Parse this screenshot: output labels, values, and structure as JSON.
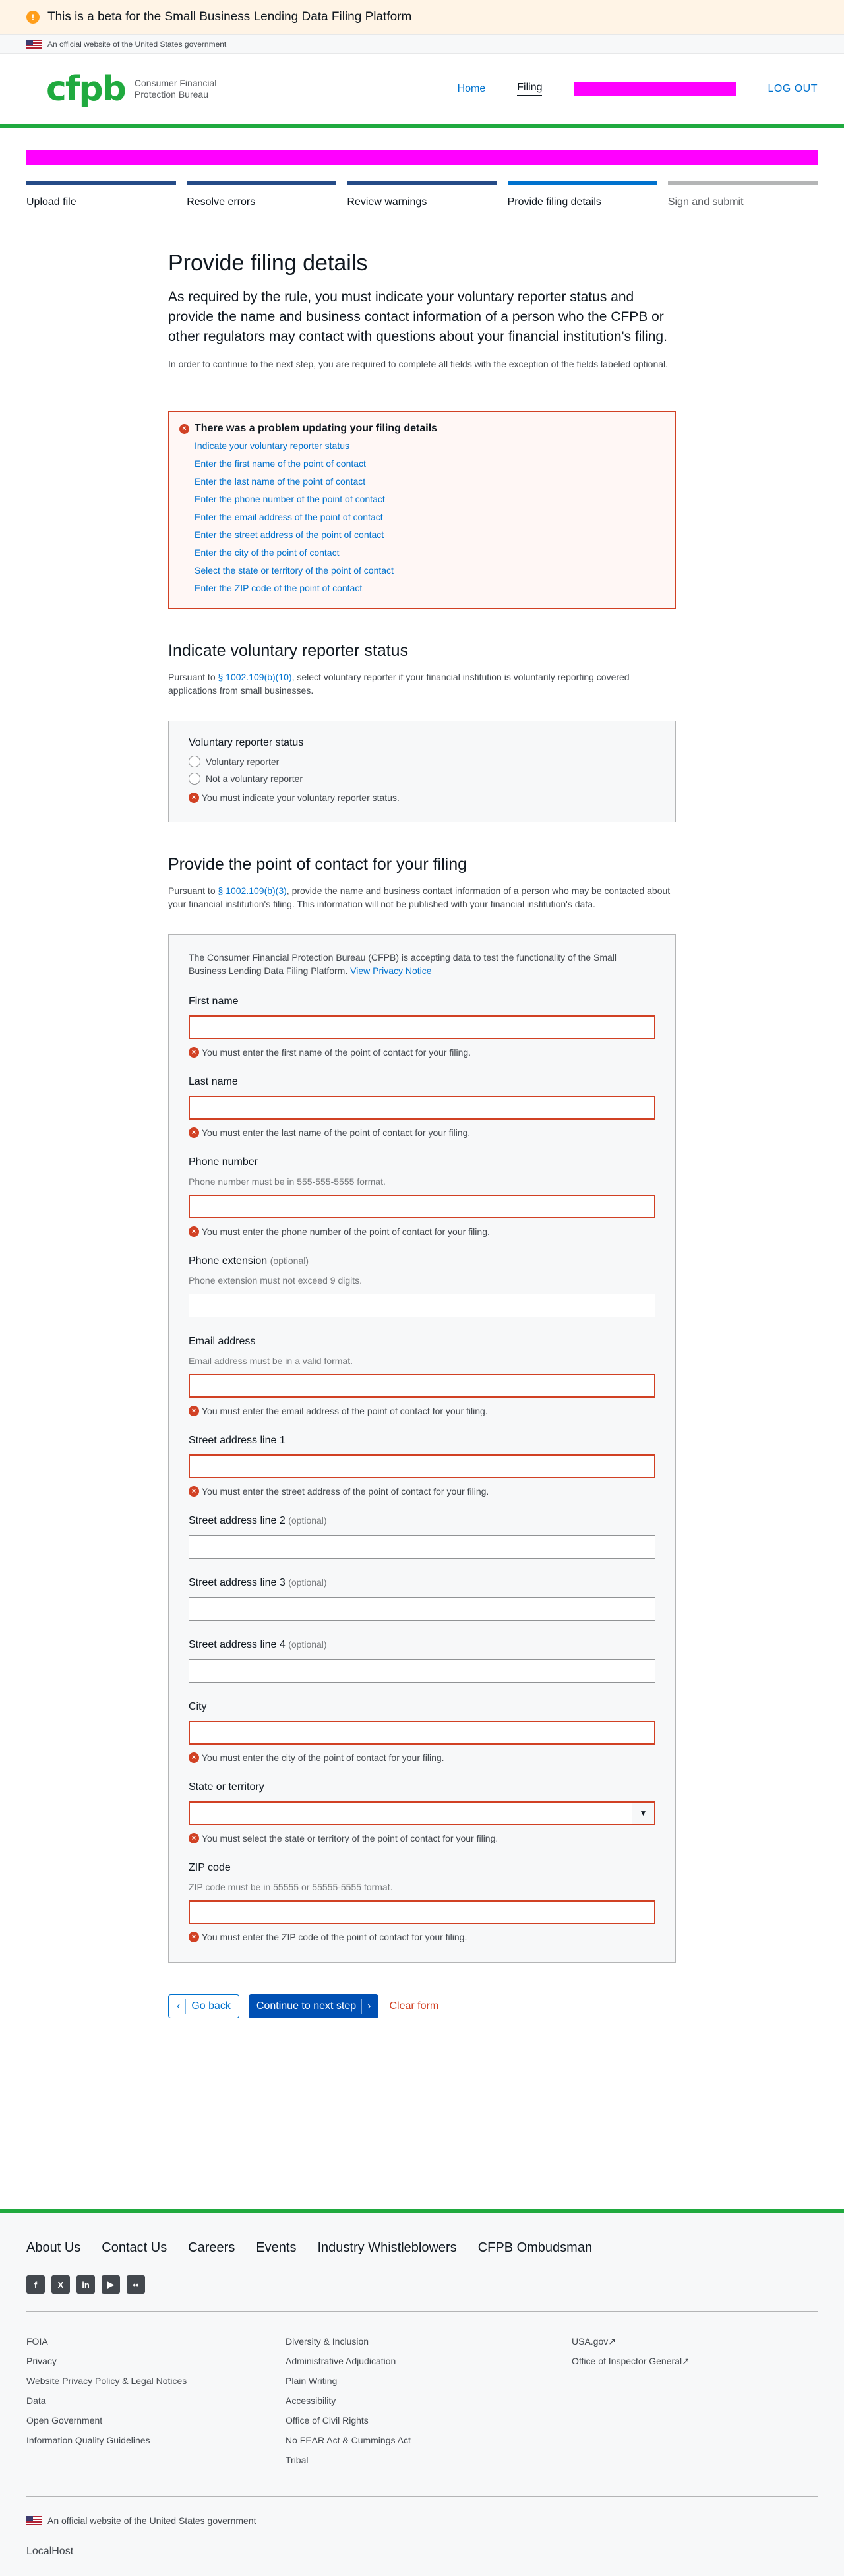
{
  "beta_banner": "This is a beta for the Small Business Lending Data Filing Platform",
  "gov_banner": "An official website of the United States government",
  "header": {
    "logo_mark": "cfpb",
    "logo_text": "Consumer Financial Protection Bureau",
    "nav": {
      "home": "Home",
      "filing": "Filing",
      "logout": "LOG OUT"
    }
  },
  "steps": [
    "Upload file",
    "Resolve errors",
    "Review warnings",
    "Provide filing details",
    "Sign and submit"
  ],
  "page": {
    "title": "Provide filing details",
    "lead": "As required by the rule, you must indicate your voluntary reporter status and provide the name and business contact information of a person who the CFPB or other regulators may contact with questions about your financial institution's filing.",
    "note": "In order to continue to the next step, you are required to complete all fields with the exception of the fields labeled optional."
  },
  "alert": {
    "title": "There was a problem updating your filing details",
    "items": [
      "Indicate your voluntary reporter status",
      "Enter the first name of the point of contact",
      "Enter the last name of the point of contact",
      "Enter the phone number of the point of contact",
      "Enter the email address of the point of contact",
      "Enter the street address of the point of contact",
      "Enter the city of the point of contact",
      "Select the state or territory of the point of contact",
      "Enter the ZIP code of the point of contact"
    ]
  },
  "voluntary": {
    "heading": "Indicate voluntary reporter status",
    "para_pre": "Pursuant to ",
    "para_link": "§ 1002.109(b)(10)",
    "para_post": ", select voluntary reporter if your financial institution is voluntarily reporting covered applications from small businesses.",
    "legend": "Voluntary reporter status",
    "options": [
      "Voluntary reporter",
      "Not a voluntary reporter"
    ],
    "error": "You must indicate your voluntary reporter status."
  },
  "contact": {
    "heading": "Provide the point of contact for your filing",
    "para_pre": "Pursuant to ",
    "para_link": "§ 1002.109(b)(3)",
    "para_post": ", provide the name and business contact information of a person who may be contacted about your financial institution's filing. This information will not be published with your financial institution's data.",
    "info_text": "The Consumer Financial Protection Bureau (CFPB) is accepting data to test the functionality of the Small Business Lending Data Filing Platform. ",
    "info_link": "View Privacy Notice",
    "optional": "(optional)",
    "first_name": {
      "label": "First name",
      "error": "You must enter the first name of the point of contact for your filing."
    },
    "last_name": {
      "label": "Last name",
      "error": "You must enter the last name of the point of contact for your filing."
    },
    "phone": {
      "label": "Phone number",
      "help": "Phone number must be in 555-555-5555 format.",
      "error": "You must enter the phone number of the point of contact for your filing."
    },
    "phone_ext": {
      "label": "Phone extension",
      "help": "Phone extension must not exceed 9 digits."
    },
    "email": {
      "label": "Email address",
      "help": "Email address must be in a valid format.",
      "error": "You must enter the email address of the point of contact for your filing."
    },
    "street1": {
      "label": "Street address line 1",
      "error": "You must enter the street address of the point of contact for your filing."
    },
    "street2": {
      "label": "Street address line 2"
    },
    "street3": {
      "label": "Street address line 3"
    },
    "street4": {
      "label": "Street address line 4"
    },
    "city": {
      "label": "City",
      "error": "You must enter the city of the point of contact for your filing."
    },
    "state": {
      "label": "State or territory",
      "error": "You must select the state or territory of the point of contact for your filing."
    },
    "zip": {
      "label": "ZIP code",
      "help": "ZIP code must be in 55555 or 55555-5555 format.",
      "error": "You must enter the ZIP code of the point of contact for your filing."
    }
  },
  "buttons": {
    "back": "Go back",
    "continue": "Continue to next step",
    "clear": "Clear form"
  },
  "footer": {
    "nav": [
      "About Us",
      "Contact Us",
      "Careers",
      "Events",
      "Industry Whistleblowers",
      "CFPB Ombudsman"
    ],
    "social": [
      "facebook-icon",
      "x-icon",
      "linkedin-icon",
      "youtube-icon",
      "flickr-icon"
    ],
    "col1": [
      "FOIA",
      "Privacy",
      "Website Privacy Policy & Legal Notices",
      "Data",
      "Open Government",
      "Information Quality Guidelines"
    ],
    "col2": [
      "Diversity & Inclusion",
      "Administrative Adjudication",
      "Plain Writing",
      "Accessibility",
      "Office of Civil Rights",
      "No FEAR Act & Cummings Act",
      "Tribal"
    ],
    "col3": [
      "USA.gov",
      "Office of Inspector General"
    ],
    "gov": "An official website of the United States government",
    "local": "LocalHost"
  }
}
